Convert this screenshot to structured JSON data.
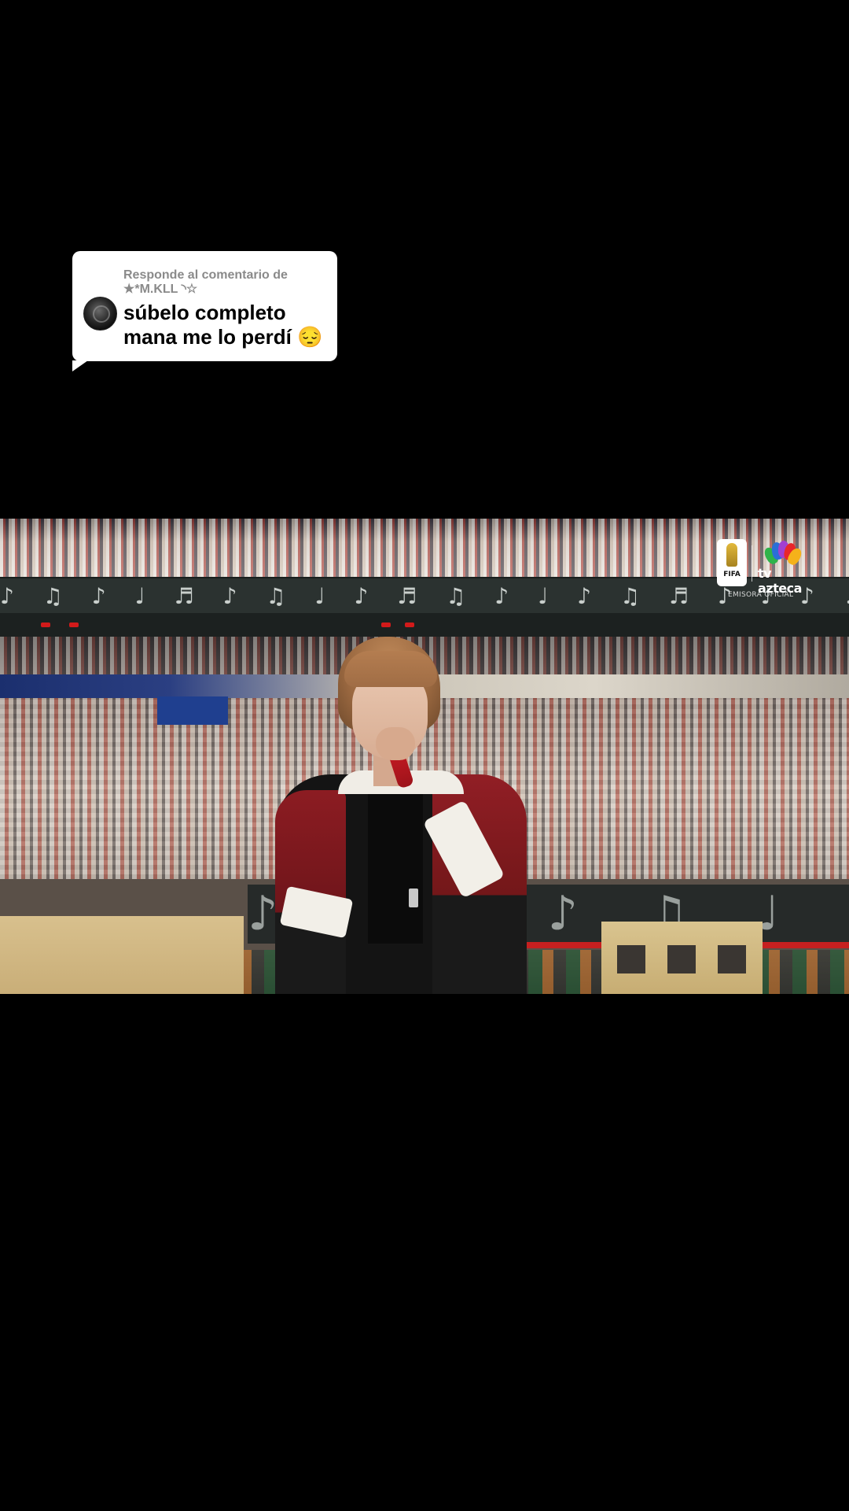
{
  "reply": {
    "header": "Responde al comentario de",
    "username": "★*M.KLL ◝☆",
    "comment": "súbelo completo mana me lo perdí 😔"
  },
  "video": {
    "broadcaster": {
      "fifa_label": "FIFA",
      "channel_name": "tv azteca",
      "channel_tagline": "EMISORA OFICIAL"
    },
    "decor": {
      "music_band": "♪ ♫ ♪ ♩ ♬ ♪ ♫ ♩ ♪ ♬ ♫ ♪ ♩ ♪ ♫ ♬ ♪ ♩ ♪ ♫ ♪ ♬ ♩ ♪ ♫ ♪ ♩ ♬ ♪ ♫",
      "barrier_notes": "♪ ♩ ♬ ♪ ♫ ♩ ♪ ♬"
    }
  },
  "colors": {
    "background": "#000000",
    "bubble": "#ffffff",
    "meta_text": "#8a8a8a",
    "comment_text": "#000000",
    "jacket_red": "#8c1c22"
  }
}
